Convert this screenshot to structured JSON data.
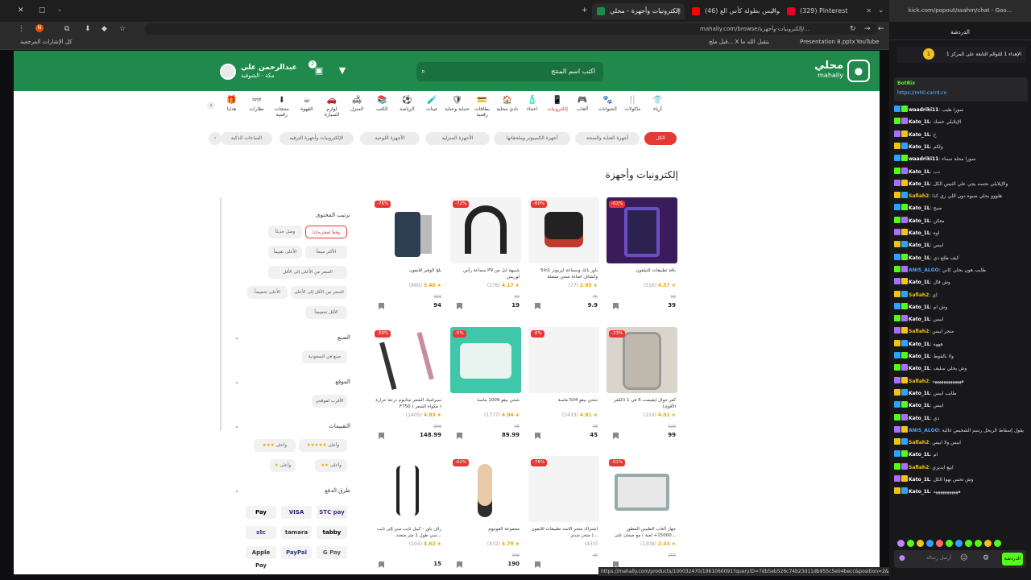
{
  "browser": {
    "tabs": [
      {
        "title": "(329) Pinterest",
        "color": "#e60023"
      },
      {
        "title": "(46) خلف كواليس بطولة كأس الع...",
        "color": "#ff0000"
      },
      {
        "title": "إلكترونيات وأجهزة - محلي",
        "color": "#1f8a4c"
      }
    ],
    "url": "mahally.com/browse/إلكترونيات-وأجهزة/...",
    "bookmarks": [
      "YouTube",
      "Presentation 8.pptx",
      "قبل ملح... X يتقبل الله ما",
      "كل الإشارات المرجعية"
    ]
  },
  "site": {
    "logo_ar": "محلي",
    "logo_en": "mahally",
    "search_placeholder": "اكتب اسم المنتج",
    "user_name": "عبدالرحمن علي",
    "user_loc": "مكة - الشوقية",
    "cart_count": "2",
    "categories": [
      "أزياء",
      "ماكولات",
      "الحيوانات",
      "ألعاب",
      "إلكترونيات",
      "اعتناء",
      "نادي محلية",
      "بطاقات رقمية",
      "حماية وعناية",
      "عينات",
      "الرياضة",
      "الكتب",
      "المنزل",
      "لوازم السيارة",
      "القهوة",
      "منتجات رقمية",
      "نظارات",
      "هدايا"
    ],
    "selected_category": "إلكترونيات",
    "subcats": [
      "الكل",
      "أجهزة العناية والصحة",
      "أجهزة الكمبيوتر وملحقاتها",
      "الأجهزة المنزلية",
      "الأجهزة اللوحية",
      "الإلكترونيات وأجهزة الترفيه",
      "الساعات الذكية"
    ],
    "page_title": "إلكترونيات وأجهزة",
    "sort_title": "ترتيب المحتوى",
    "sort_options": [
      "وفقاً لمقترحاتنا",
      "وصل حديثاً",
      "الأكثر مبيعاً",
      "الأعلى تقييماً",
      "السعر من الأعلى إلى الأقل",
      "السعر من الأقل إلى الأعلى",
      "الأعلى تخفيضاً",
      "الأقل تخفيضاً"
    ],
    "brand_title": "الصنع",
    "brand_option": "صنع في السعودية",
    "location_title": "الموقع",
    "location_option": "الأقرب لموقعي",
    "ratings_title": "التقييمات",
    "rating_options": [
      "وأعلى",
      "وأعلى",
      "وأعلى",
      "وأعلى"
    ],
    "payment_title": "طرق الدفع",
    "payments": [
      "STC pay",
      "VISA",
      "Pay",
      "tabby",
      "tamara",
      "stc",
      "G Pay",
      "PayPal",
      "Apple Pay"
    ]
  },
  "products": [
    {
      "name": "باقة تطبيقات للتيلفون",
      "rating": "4.57",
      "count": "(516)",
      "old": "99",
      "price": "39",
      "disc": "-61%",
      "bg": "#3a1b5c"
    },
    {
      "name": "5in1 باور بانك وسماعة ايربودز وكشاف اضاءة شحن متصلة",
      "rating": "2.95",
      "count": "(77)",
      "old": "75",
      "price": "9.9",
      "disc": "-60%",
      "bg": "#f4f4f4"
    },
    {
      "name": "سماعة رأس P9 شبيهة ابل من لوريس",
      "rating": "4.17",
      "count": "(276)",
      "old": "69",
      "price": "19",
      "disc": "-72%",
      "bg": "#f4f4f4"
    },
    {
      "name": "بلج الوفير للايفون",
      "rating": "3.40",
      "count": "(960)",
      "old": "399",
      "price": "94",
      "disc": "-76%",
      "bg": "#ffffff"
    },
    {
      "name": "كفر جوال ايفيست 6 في 1 (الكفر الأقوى)",
      "rating": "4.01",
      "count": "(210)",
      "old": "129",
      "price": "99",
      "disc": "-23%",
      "bg": "#d9d4cc"
    },
    {
      "name": "شحن بيقو 504 ماسة",
      "rating": "4.91",
      "count": "(2433)",
      "old": "48",
      "price": "45",
      "disc": "-6%",
      "bg": "#f4f4f4"
    },
    {
      "name": "شحن بيقو 1009 ماسة",
      "rating": "4.94",
      "count": "(1777)",
      "old": "95",
      "price": "89.99",
      "disc": "-5%",
      "bg": "#3ec7a8"
    },
    {
      "name": "سيراميك الشعر تيتانيوم درجة حرارة F750 ( مكواة الشعر )",
      "rating": "4.83",
      "count": "(1405)",
      "old": "299",
      "price": "148.99",
      "disc": "-50%",
      "bg": "#ffffff"
    },
    {
      "name": "جهاز ألعاب الطيبين المطور 15000+ لعبة ) مع ضمان على...",
      "rating": "2.43",
      "count": "(1309)",
      "old": "250",
      "price": "",
      "disc": "-51%",
      "bg": "#ffffff"
    },
    {
      "name": "اشتراك متجر الاسد تطبيقات للايفون ( متجر شدي...",
      "rating": "",
      "count": "(433)",
      "old": "70",
      "price": "",
      "disc": "-76%",
      "bg": "#f4f4f4"
    },
    {
      "name": "مجموعة الفوتيوم",
      "rating": "4.79",
      "count": "(432)",
      "old": "499",
      "price": "190",
      "disc": "-62%",
      "bg": "#ffffff"
    },
    {
      "name": "راف باور - كيبل تايب سي إلى تايب سي طول 1 متر متعدد...",
      "rating": "4.62",
      "count": "(104)",
      "old": "",
      "price": "15",
      "disc": "",
      "bg": "#ffffff"
    }
  ],
  "chat": {
    "url": "kick.com/popout/ssahm/chat - Goo...",
    "header": "الدردشة",
    "pinned": "الإهداء 1 للثوالم التابعة على المركز 1",
    "bot_name": "BotRix",
    "bot_link": "https://mh0.carrd.co",
    "messages": [
      {
        "u": "waadriki11",
        "t": "سورا طيب",
        "c": "#ffffff"
      },
      {
        "u": "Kato_1L",
        "t": "الإيلايلي خضك",
        "c": "#ffffff"
      },
      {
        "u": "Kato_1L",
        "t": "ح",
        "c": "#ffffff"
      },
      {
        "u": "Kato_1L",
        "t": "ولكم",
        "c": "#ffffff"
      },
      {
        "u": "waadriki11",
        "t": "سورا محلة سماء",
        "c": "#ffffff"
      },
      {
        "u": "Kato_1L",
        "t": "دب",
        "c": "#ffffff"
      },
      {
        "u": "Kato_1L",
        "t": "والإيلايلي نحصه يجي علي الثيس الكل",
        "c": "#ffffff"
      },
      {
        "u": "Safiah2",
        "t": "هلووو يحلي ضبوه دون اللي زي كذا",
        "c": "#f1c21b"
      },
      {
        "u": "Kato_1L",
        "t": "صبح",
        "c": "#ffffff"
      },
      {
        "u": "Kato_1L",
        "t": "معكن",
        "c": "#ffffff"
      },
      {
        "u": "Kato_1L",
        "t": "اوه",
        "c": "#ffffff"
      },
      {
        "u": "Kato_1L",
        "t": "ابيس",
        "c": "#ffffff"
      },
      {
        "u": "Kato_1L",
        "t": "كيف طلع ذي",
        "c": "#ffffff"
      },
      {
        "u": "ANIS_ALGO",
        "t": "طايب هون يحلي كاني",
        "c": "#4aa3ff"
      },
      {
        "u": "Kato_1L",
        "t": "وش قال",
        "c": "#ffffff"
      },
      {
        "u": "Safiah2",
        "t": "اي",
        "c": "#f1c21b"
      },
      {
        "u": "Kato_1L",
        "t": "وش ام",
        "c": "#ffffff"
      },
      {
        "u": "Kato_1L",
        "t": "ابيس",
        "c": "#ffffff"
      },
      {
        "u": "Safiah2",
        "t": "متجر ابيس",
        "c": "#f1c21b"
      },
      {
        "u": "Kato_1L",
        "t": "هههه",
        "c": "#ffffff"
      },
      {
        "u": "Kato_1L",
        "t": "ولا بالقوط",
        "c": "#ffffff"
      },
      {
        "u": "Kato_1L",
        "t": "وش يحلي سليف",
        "c": "#ffffff"
      },
      {
        "u": "Safiah2",
        "t": "هههههههههههههه",
        "c": "#f1c21b"
      },
      {
        "u": "Kato_1L",
        "t": "طايب ابيس",
        "c": "#ffffff"
      },
      {
        "u": "Kato_1L",
        "t": "ابيس",
        "c": "#ffffff"
      },
      {
        "u": "Kato_1L",
        "t": "دي",
        "c": "#ffffff"
      },
      {
        "u": "ANIS_ALGO",
        "t": "يقول إسقاط الريحل رسم الشخيص غالبة",
        "c": "#4aa3ff"
      },
      {
        "u": "Safiah2",
        "t": "ايبس ولا ابيس",
        "c": "#f1c21b"
      },
      {
        "u": "Kato_1L",
        "t": "ام",
        "c": "#ffffff"
      },
      {
        "u": "Safiah2",
        "t": "ابيع ايديزي",
        "c": "#f1c21b"
      },
      {
        "u": "Kato_1L",
        "t": "وش تحس تهوا الكل",
        "c": "#ffffff"
      },
      {
        "u": "Kato_1L",
        "t": "هههههههههههه",
        "c": "#ffffff"
      }
    ],
    "send": "الدردشة",
    "input_placeholder": "أرسل رسالة"
  },
  "statusbar": "https://mahally.com/products/100032470/1961060091?queryID=7db5eb526c74b23d11db955c5e04becc&position=2&index=produ..."
}
